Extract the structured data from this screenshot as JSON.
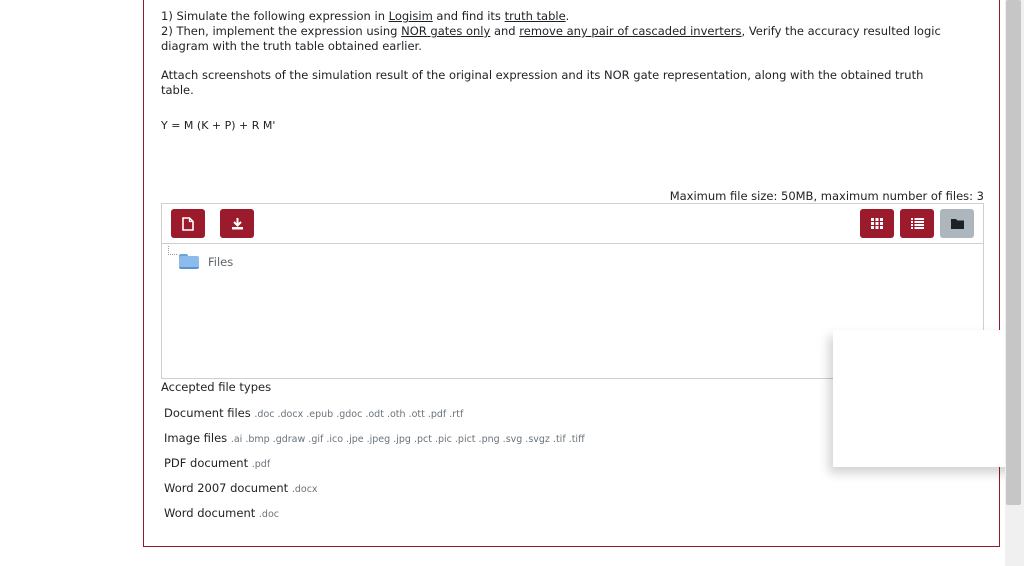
{
  "question": {
    "line1": {
      "n": "1) Simulate the following expression in ",
      "u1": "Logisim",
      "m1": " and find its ",
      "u2": "truth table",
      "end": "."
    },
    "line2": {
      "n": "2) Then, implement the expression using ",
      "u1": "NOR gates only",
      "m1": " and ",
      "u2": "remove any pair of cascaded inverters",
      "end": ", Verify the accuracy resulted logic"
    },
    "line3": "diagram with the truth table obtained earlier.",
    "attach1": "Attach screenshots of the simulation result of the original expression and its NOR gate representation, along with the obtained truth",
    "attach2": "table.",
    "formula": "Y = M (K + P) + R M'"
  },
  "filemanager": {
    "max_text": "Maximum file size: 50MB, maximum number of files: 3",
    "folder_label": "Files",
    "buttons": {
      "add_file": "file-icon",
      "download": "download-icon",
      "view_icons": "grid-icon",
      "view_list": "list-icon",
      "view_tree": "folder-icon"
    },
    "accent": "#9b1b2c",
    "inactive": "#aeb6bd"
  },
  "accepted": {
    "title": "Accepted file types",
    "types": [
      {
        "name": "Document files",
        "ext": ".doc .docx .epub .gdoc .odt .oth .ott .pdf .rtf"
      },
      {
        "name": "Image files",
        "ext": ".ai .bmp .gdraw .gif .ico .jpe .jpeg .jpg .pct .pic .pict .png .svg .svgz .tif .tiff"
      },
      {
        "name": "PDF document",
        "ext": ".pdf"
      },
      {
        "name": "Word 2007 document",
        "ext": ".docx"
      },
      {
        "name": "Word document",
        "ext": ".doc"
      }
    ]
  }
}
